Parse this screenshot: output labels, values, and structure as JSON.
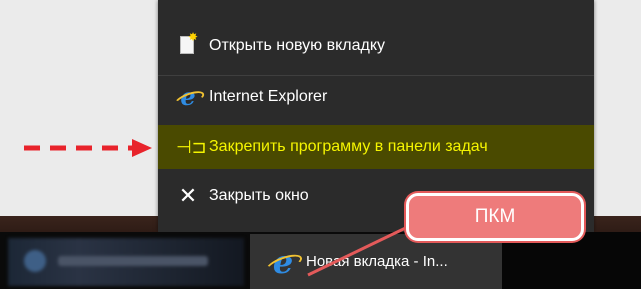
{
  "jump_list": {
    "items": [
      {
        "label": "Открыть новую вкладку",
        "icon": "new-tab-icon"
      },
      {
        "label": "Internet Explorer",
        "icon": "internet-explorer-icon"
      },
      {
        "label": "Закрепить программу в панели задач",
        "icon": "pin-icon"
      },
      {
        "label": "Закрыть окно",
        "icon": "close-icon"
      }
    ]
  },
  "taskbar": {
    "active_button_label": "Новая вкладка - In..."
  },
  "annotation": {
    "callout_text": "ПКМ"
  },
  "colors": {
    "menu_bg": "#2b2b2b",
    "highlight_bg": "#4a4a00",
    "highlight_text": "#f5f500",
    "taskbar_bg": "#0a0a0a",
    "annotation_red": "#e8232b",
    "callout_fill": "#ee7b7b"
  }
}
